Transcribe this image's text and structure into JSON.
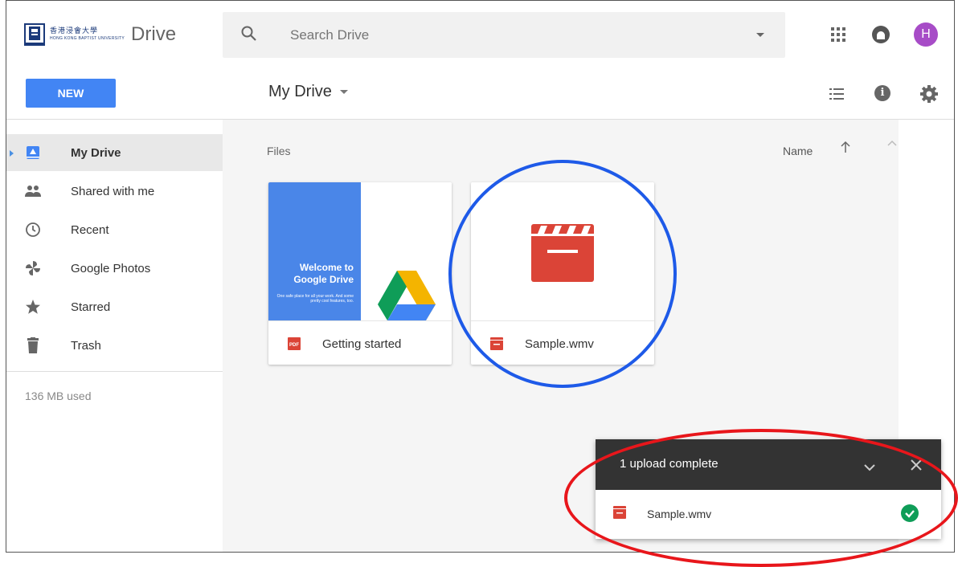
{
  "header": {
    "logo_chinese": "香港浸會大學",
    "logo_english": "HONG KONG BAPTIST UNIVERSITY",
    "app_name": "Drive",
    "search_placeholder": "Search Drive",
    "avatar_initial": "H"
  },
  "toolbar": {
    "new_label": "NEW",
    "breadcrumb": "My Drive",
    "info_glyph": "i"
  },
  "sidebar": {
    "items": [
      {
        "label": "My Drive",
        "icon": "drive-icon",
        "active": true
      },
      {
        "label": "Shared with me",
        "icon": "people-icon"
      },
      {
        "label": "Recent",
        "icon": "clock-icon"
      },
      {
        "label": "Google Photos",
        "icon": "pinwheel-icon"
      },
      {
        "label": "Starred",
        "icon": "star-icon"
      },
      {
        "label": "Trash",
        "icon": "trash-icon"
      }
    ],
    "storage": "136 MB used"
  },
  "main": {
    "section_label": "Files",
    "sort_label": "Name",
    "files": [
      {
        "name": "Getting started",
        "type": "pdf",
        "type_badge": "PDF",
        "thumb_title": "Welcome to Google Drive",
        "thumb_subtitle": "One safe place for all your work. And some pretty cool features, too."
      },
      {
        "name": "Sample.wmv",
        "type": "video"
      }
    ]
  },
  "upload_panel": {
    "title": "1 upload complete",
    "items": [
      {
        "name": "Sample.wmv",
        "status": "complete"
      }
    ]
  },
  "colors": {
    "accent": "#4285f4",
    "video_red": "#db4437",
    "avatar": "#a74cc7",
    "success": "#0f9d58",
    "annotation_blue": "#1e5ae8",
    "annotation_red": "#e8161b"
  }
}
